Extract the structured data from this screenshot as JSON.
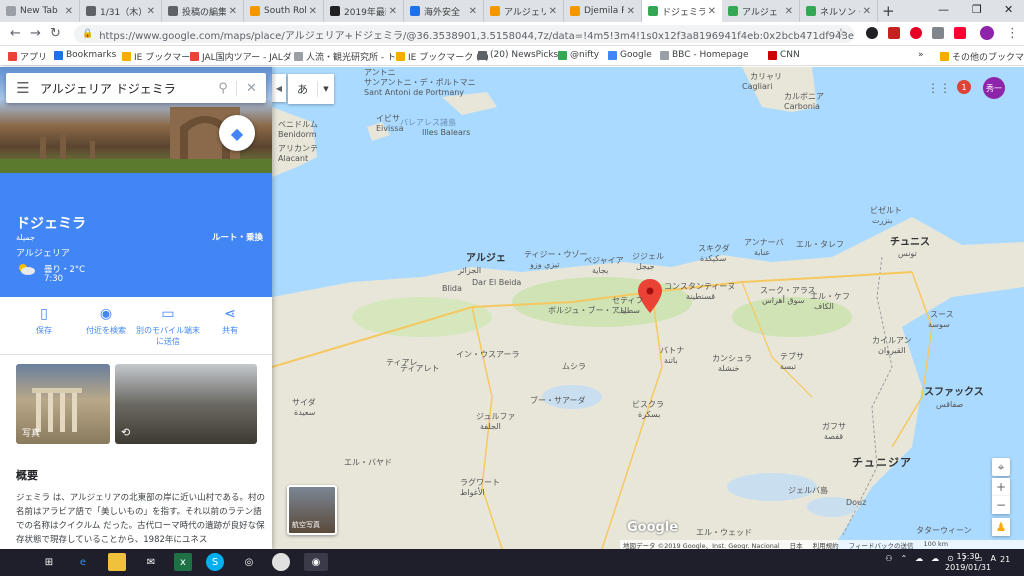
{
  "tabs": [
    {
      "title": "New Tab",
      "color": "#9aa0a6"
    },
    {
      "title": "1/31（木）",
      "color": "#5f6368"
    },
    {
      "title": "投稿の編集",
      "color": "#5f6368"
    },
    {
      "title": "South Rob",
      "color": "#f29900"
    },
    {
      "title": "2019年最新",
      "color": "#202124"
    },
    {
      "title": "海外安全",
      "color": "#1a73e8"
    },
    {
      "title": "アルジェリア",
      "color": "#f29900"
    },
    {
      "title": "Djemila R",
      "color": "#f29900"
    },
    {
      "title": "ドジェミラ",
      "color": "#34a853"
    },
    {
      "title": "アルジェ",
      "color": "#34a853"
    },
    {
      "title": "ネルソン・マ",
      "color": "#34a853"
    }
  ],
  "omnibox": {
    "url": "https://www.google.com/maps/place/アルジェリア+ドジェミラ/@36.3538901,3.5158044,7z/data=!4m5!3m4!1s0x12f3a8196941f4eb:0x2bcb471df943ee96!8m2!3d36.3179676!4d5.793..."
  },
  "bookmarks": [
    {
      "label": "アプリ",
      "color": "#ea4335"
    },
    {
      "label": "Bookmarks",
      "color": "#1a73e8"
    },
    {
      "label": "IE ブックマーク",
      "color": "#f9ab00"
    },
    {
      "label": "JAL国内ツアー - JALダ",
      "color": "#ea4335"
    },
    {
      "label": "人流・観光研究所 - ト",
      "color": "#9aa0a6"
    },
    {
      "label": "IE ブックマーク (1)",
      "color": "#f9ab00"
    },
    {
      "label": "(20) NewsPicks",
      "color": "#5f6368"
    },
    {
      "label": "@nifty",
      "color": "#34a853"
    },
    {
      "label": "Google",
      "color": "#4285f4"
    },
    {
      "label": "BBC - Homepage",
      "color": "#9aa0a6"
    },
    {
      "label": "CNN",
      "color": "#cc0000"
    },
    {
      "label": "その他のブックマーク",
      "color": "#f9ab00"
    }
  ],
  "search": {
    "query": "アルジェリア ドジェミラ"
  },
  "place": {
    "name": "ドジェミラ",
    "name_ar": "جميلة",
    "country": "アルジェリア",
    "weather": "曇り・2°C",
    "time": "7:30",
    "route_label": "ルート・乗換"
  },
  "actions": [
    {
      "label": "保存",
      "icon": "bookmark-icon",
      "glyph": "🔖"
    },
    {
      "label": "付近を検索",
      "icon": "nearby-icon",
      "glyph": "◎"
    },
    {
      "label": "別のモバイル端末に送信",
      "icon": "send-to-device-icon",
      "glyph": "▭"
    },
    {
      "label": "共有",
      "icon": "share-icon",
      "glyph": "⋖"
    }
  ],
  "photos": {
    "photo_label": "写真",
    "sv_label": ""
  },
  "overview": {
    "title": "概要",
    "text": "ジェミラ は、アルジェリアの北東部の岸に近い山村である。村の名前はアラビア語で「美しいもの」を指す。それ以前のラテン語での名称はクイクルム だった。古代ローマ時代の遺跡が良好な保存状態で現存していることから、1982年にユネス"
  },
  "map": {
    "layer_label": "あ",
    "aerial_label": "航空写真",
    "google": "Google",
    "footer": [
      "地図データ ©2019 Google、Inst. Geogr. Nacional",
      "日本",
      "利用規約",
      "フィードバックの送信",
      "100 km"
    ],
    "labels": [
      {
        "text": "Cagliari",
        "cls": ""
      },
      {
        "text": "カリャリ",
        "cls": ""
      },
      {
        "text": "Carbonia",
        "cls": ""
      },
      {
        "text": "カルボニア",
        "cls": ""
      },
      {
        "text": "Sant Antoni de Portmany",
        "cls": ""
      },
      {
        "text": "サンアントニ・デ・ポルトマニ",
        "cls": ""
      },
      {
        "text": "アントニ",
        "cls": ""
      },
      {
        "text": "イビサ",
        "cls": ""
      },
      {
        "text": "Eivissa",
        "cls": ""
      },
      {
        "text": "バレアレス諸島",
        "cls": "sea"
      },
      {
        "text": "Illes Balears",
        "cls": ""
      },
      {
        "text": "ベニドルム",
        "cls": ""
      },
      {
        "text": "Benidorm",
        "cls": ""
      },
      {
        "text": "アリカンテ",
        "cls": ""
      },
      {
        "text": "Alacant",
        "cls": ""
      },
      {
        "text": "ビゼルト",
        "cls": ""
      },
      {
        "text": "بنزرت",
        "cls": ""
      },
      {
        "text": "チュニス",
        "cls": "big"
      },
      {
        "text": "تونس",
        "cls": ""
      },
      {
        "text": "アルジェ",
        "cls": "big"
      },
      {
        "text": "الجزائر",
        "cls": ""
      },
      {
        "text": "ティアレト",
        "cls": ""
      },
      {
        "text": "ティジー・ウゾー",
        "cls": ""
      },
      {
        "text": "تيزي وزو",
        "cls": ""
      },
      {
        "text": "ベジャイア",
        "cls": ""
      },
      {
        "text": "بجاية",
        "cls": ""
      },
      {
        "text": "ジジェル",
        "cls": ""
      },
      {
        "text": "جيجل",
        "cls": ""
      },
      {
        "text": "スキクダ",
        "cls": ""
      },
      {
        "text": "سكيكدة",
        "cls": ""
      },
      {
        "text": "アンナーバ",
        "cls": ""
      },
      {
        "text": "عنابة",
        "cls": ""
      },
      {
        "text": "エル・タレフ",
        "cls": ""
      },
      {
        "text": "コンスタンティーヌ",
        "cls": ""
      },
      {
        "text": "قسنطينة",
        "cls": ""
      },
      {
        "text": "セティフ",
        "cls": ""
      },
      {
        "text": "سطيف",
        "cls": ""
      },
      {
        "text": "スーク・アラス",
        "cls": ""
      },
      {
        "text": "سوق أهراس",
        "cls": ""
      },
      {
        "text": "エル・ケフ",
        "cls": ""
      },
      {
        "text": "الكاف",
        "cls": ""
      },
      {
        "text": "スース",
        "cls": ""
      },
      {
        "text": "سوسة",
        "cls": ""
      },
      {
        "text": "ボルジュ・ブー・アリ",
        "cls": ""
      },
      {
        "text": "ブー・サアーダ",
        "cls": ""
      },
      {
        "text": "ティアレ",
        "cls": ""
      },
      {
        "text": "イン・ウスアーラ",
        "cls": ""
      },
      {
        "text": "ムシラ",
        "cls": ""
      },
      {
        "text": "バトナ",
        "cls": ""
      },
      {
        "text": "باتنة",
        "cls": ""
      },
      {
        "text": "カイルアン",
        "cls": ""
      },
      {
        "text": "القيروان",
        "cls": ""
      },
      {
        "text": "カンシュラ",
        "cls": ""
      },
      {
        "text": "خنشلة",
        "cls": ""
      },
      {
        "text": "テブサ",
        "cls": ""
      },
      {
        "text": "تبسة",
        "cls": ""
      },
      {
        "text": "スファックス",
        "cls": "big"
      },
      {
        "text": "صفاقس",
        "cls": ""
      },
      {
        "text": "ビスクラ",
        "cls": ""
      },
      {
        "text": "بسكرة",
        "cls": ""
      },
      {
        "text": "ガフサ",
        "cls": ""
      },
      {
        "text": "قفصة",
        "cls": ""
      },
      {
        "text": "サイダ",
        "cls": ""
      },
      {
        "text": "سعيدة",
        "cls": ""
      },
      {
        "text": "ジュルファ",
        "cls": ""
      },
      {
        "text": "الجلفة",
        "cls": ""
      },
      {
        "text": "チュニジア",
        "cls": "country"
      },
      {
        "text": "ラグワート",
        "cls": ""
      },
      {
        "text": "الأغواط",
        "cls": ""
      },
      {
        "text": "エル・ウェッド",
        "cls": ""
      },
      {
        "text": "ジェルバ島",
        "cls": ""
      },
      {
        "text": "Douz",
        "cls": ""
      },
      {
        "text": "タターウィーン",
        "cls": ""
      },
      {
        "text": "エル・バヤド",
        "cls": ""
      },
      {
        "text": "Dar El Beida",
        "cls": ""
      },
      {
        "text": "Blida",
        "cls": ""
      }
    ]
  },
  "account": {
    "initials": "秀一",
    "notifications": "1"
  },
  "taskbar": {
    "time": "15:30",
    "date": "2019/01/31",
    "lang": "A",
    "notif": "21"
  },
  "colors": {
    "blue": "#4285f4",
    "marker": "#ea4335",
    "sea": "#aadaff",
    "land": "#e8e6d9"
  }
}
